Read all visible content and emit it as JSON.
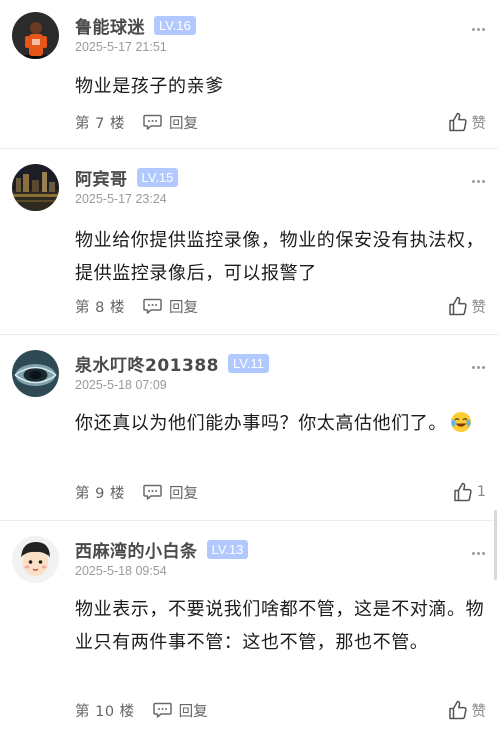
{
  "comments": [
    {
      "username": "鲁能球迷",
      "level": "LV.16",
      "time": "2025-5-17 21:51",
      "content": "物业是孩子的亲爹",
      "floor": "第 7 楼",
      "reply_label": "回复",
      "like_label": "赞",
      "avatar_icon": "soccer-player-avatar"
    },
    {
      "username": "阿宾哥",
      "level": "LV.15",
      "time": "2025-5-17 23:24",
      "content": "物业给你提供监控录像，物业的保安没有执法权，提供监控录像后，可以报警了",
      "floor": "第 8 楼",
      "reply_label": "回复",
      "like_label": "赞",
      "avatar_icon": "city-night-avatar"
    },
    {
      "username": "泉水叮咚201388",
      "level": "LV.11",
      "time": "2025-5-18 07:09",
      "content": "你还真以为他们能办事吗？你太高估他们了。",
      "floor": "第 9 楼",
      "reply_label": "回复",
      "like_label": "1",
      "avatar_icon": "water-eye-avatar",
      "emoji": "laugh-cry-emoji"
    },
    {
      "username": "西麻湾的小白条",
      "level": "LV.13",
      "time": "2025-5-18 09:54",
      "content": "物业表示，不要说我们啥都不管，这是不对滴。物业只有两件事不管：这也不管，那也不管。",
      "floor": "第 10 楼",
      "reply_label": "回复",
      "like_label": "赞",
      "avatar_icon": "cartoon-boy-avatar"
    }
  ],
  "colors": {
    "level_badge": "#b1c9ff",
    "username": "#4a4a4a",
    "meta": "#9a9a9a"
  }
}
